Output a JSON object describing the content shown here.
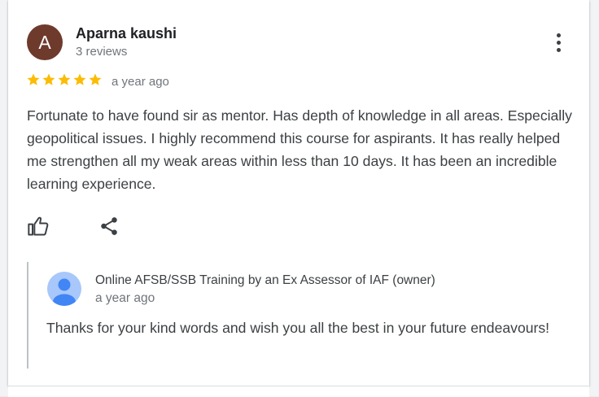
{
  "review": {
    "author_initial": "A",
    "author_name": "Aparna kaushi",
    "author_reviews": "3 reviews",
    "rating": 5,
    "max_rating": 5,
    "time": "a year ago",
    "text": "Fortunate to have found sir as mentor. Has depth of knowledge in all areas. Especially geopolitical issues. I highly recommend this course for aspirants. It has really helped me strengthen all my weak areas within less than 10 days. It has been an incredible learning experience."
  },
  "owner_reply": {
    "name": "Online AFSB/SSB Training by an Ex Assessor of IAF (owner)",
    "time": "a year ago",
    "text": "Thanks for your kind words and wish you all the best in your future endeavours!"
  },
  "colors": {
    "avatar_bg": "#6d3a2c",
    "star": "#fbbc04",
    "owner_avatar_bg": "#a8c7fa",
    "owner_avatar_fg": "#4285f4"
  }
}
